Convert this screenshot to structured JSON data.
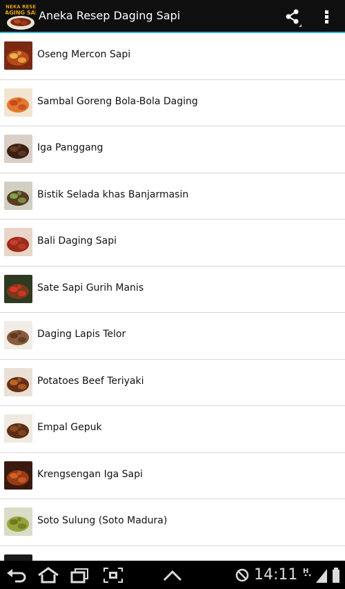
{
  "app": {
    "title": "Aneka Resep Daging Sapi",
    "icon_text_line1": "ANEKA RESEP",
    "icon_text_line2": "DAGING SAPI",
    "accent_color": "#33b5e5"
  },
  "actions": {
    "share_icon": "share-icon",
    "overflow_icon": "overflow-menu-icon"
  },
  "recipes": [
    {
      "label": "Oseng Mercon Sapi",
      "thumb": {
        "bg": "#7a2a12",
        "food": "#b8491c",
        "accent": "#e8b24a"
      }
    },
    {
      "label": "Sambal Goreng Bola-Bola Daging",
      "thumb": {
        "bg": "#f2e4d0",
        "food": "#e07a2e",
        "accent": "#c9481c"
      }
    },
    {
      "label": "Iga Panggang",
      "thumb": {
        "bg": "#d9cfc6",
        "food": "#3a1f14",
        "accent": "#6a3a22"
      }
    },
    {
      "label": "Bistik Selada khas Banjarmasin",
      "thumb": {
        "bg": "#cfcfc2",
        "food": "#5a3a22",
        "accent": "#7da34a"
      }
    },
    {
      "label": "Bali Daging Sapi",
      "thumb": {
        "bg": "#e8d5c8",
        "food": "#9b2a1a",
        "accent": "#c0402a"
      }
    },
    {
      "label": "Sate Sapi Gurih Manis",
      "thumb": {
        "bg": "#2f3a22",
        "food": "#7a3a1a",
        "accent": "#e0332a"
      }
    },
    {
      "label": "Daging Lapis Telor",
      "thumb": {
        "bg": "#f0ece6",
        "food": "#8a5a3a",
        "accent": "#5a3a22"
      }
    },
    {
      "label": "Potatoes Beef Teriyaki",
      "thumb": {
        "bg": "#e9e1d6",
        "food": "#6a2e14",
        "accent": "#b8662a"
      }
    },
    {
      "label": "Empal Gepuk",
      "thumb": {
        "bg": "#efe9e0",
        "food": "#5a2e14",
        "accent": "#8a4a22"
      }
    },
    {
      "label": "Krengsengan Iga Sapi",
      "thumb": {
        "bg": "#3a1a0e",
        "food": "#9a3a14",
        "accent": "#d0602a"
      }
    },
    {
      "label": "Soto Sulung (Soto Madura)",
      "thumb": {
        "bg": "#d8dcc8",
        "food": "#9aa23a",
        "accent": "#6a7a22"
      }
    },
    {
      "label": "",
      "thumb": {
        "bg": "#1a1a1a",
        "food": "#2a2a2a",
        "accent": "#8a8a8a"
      }
    }
  ],
  "system": {
    "clock": "14:11",
    "nav_icons": [
      "back-icon",
      "home-icon",
      "recent-apps-icon",
      "screenshot-icon",
      "menu-up-icon"
    ],
    "status_icons": [
      "no-sync-icon",
      "hsdpa-icon",
      "signal-icon",
      "battery-icon"
    ]
  }
}
